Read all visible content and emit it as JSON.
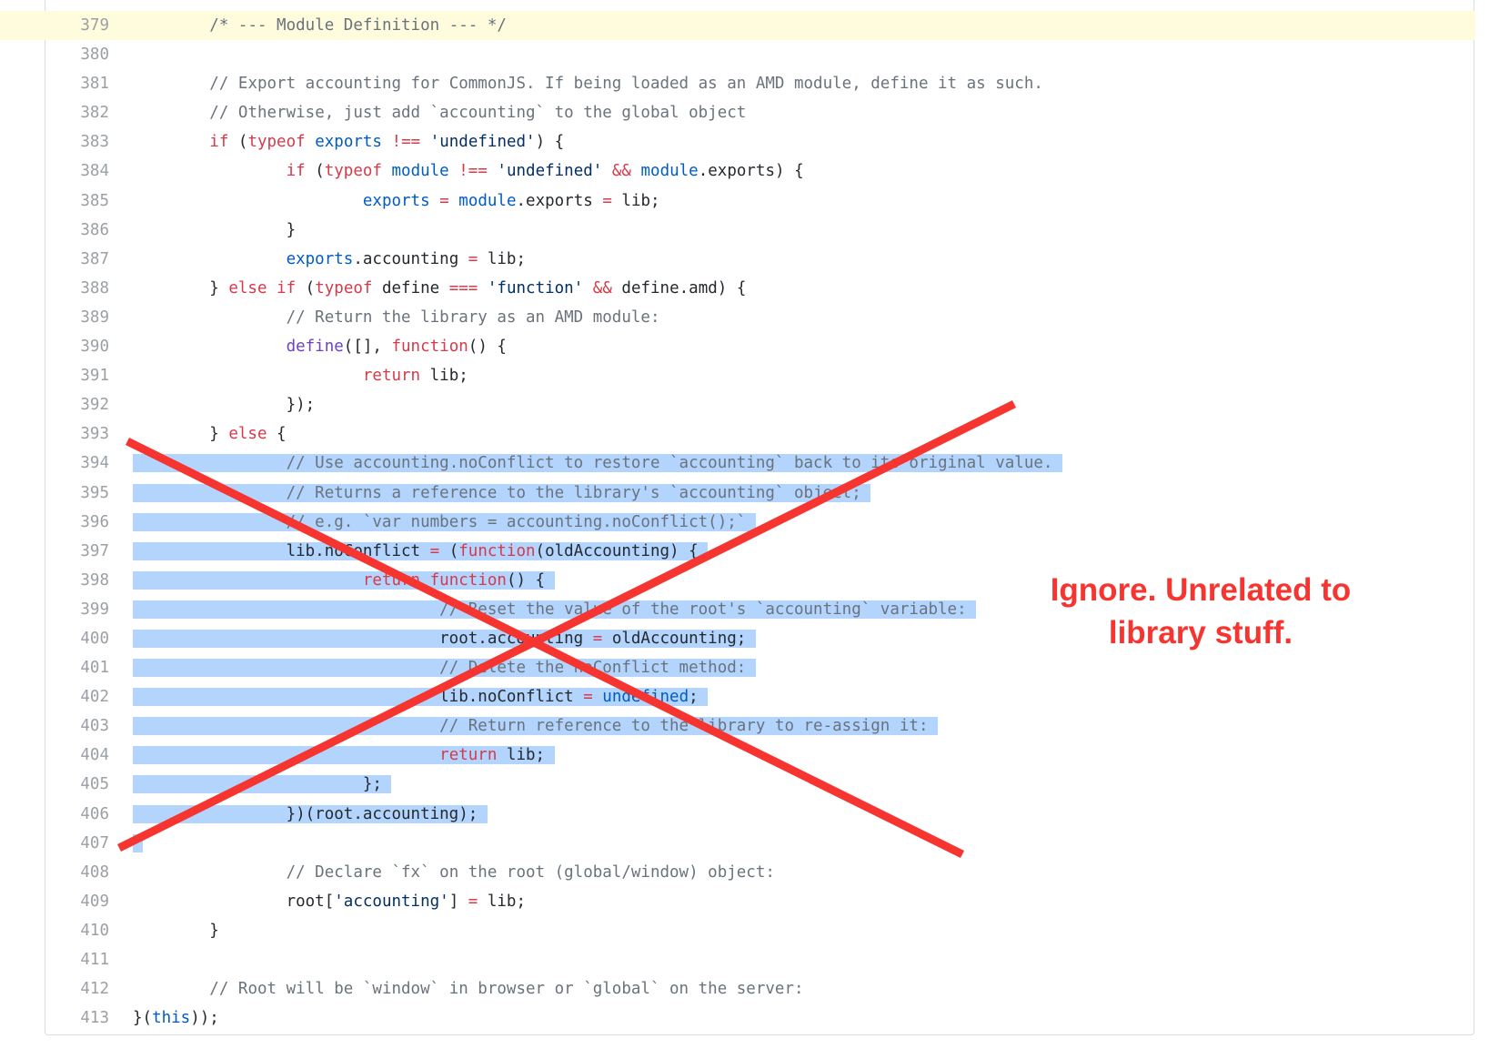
{
  "expander": {
    "label": "•••"
  },
  "highlight_line": "379",
  "selection": {
    "from": "394",
    "to": "407"
  },
  "annotation": {
    "line1": "Ignore. Unrelated to",
    "line2": "library stuff.",
    "color": "#f63531"
  },
  "lines": [
    {
      "num": "379",
      "html": "\t<span class=\"c\">/* --- Module Definition --- */</span>"
    },
    {
      "num": "380",
      "html": ""
    },
    {
      "num": "381",
      "html": "\t<span class=\"c\">// Export accounting for CommonJS. If being loaded as an AMD module, define it as such.</span>"
    },
    {
      "num": "382",
      "html": "\t<span class=\"c\">// Otherwise, just add `accounting` to the global object</span>"
    },
    {
      "num": "383",
      "html": "\t<span class=\"k\">if</span> (<span class=\"k\">typeof</span> <span class=\"v\">exports</span> <span class=\"k\">!==</span> <span class=\"s\">'undefined'</span>) {"
    },
    {
      "num": "384",
      "html": "\t\t<span class=\"k\">if</span> (<span class=\"k\">typeof</span> <span class=\"v\">module</span> <span class=\"k\">!==</span> <span class=\"s\">'undefined'</span> <span class=\"k\">&amp;&amp;</span> <span class=\"v\">module</span>.exports) {"
    },
    {
      "num": "385",
      "html": "\t\t\t<span class=\"v\">exports</span> <span class=\"k\">=</span> <span class=\"v\">module</span>.exports <span class=\"k\">=</span> lib;"
    },
    {
      "num": "386",
      "html": "\t\t}"
    },
    {
      "num": "387",
      "html": "\t\t<span class=\"v\">exports</span>.accounting <span class=\"k\">=</span> lib;"
    },
    {
      "num": "388",
      "html": "\t} <span class=\"k\">else</span> <span class=\"k\">if</span> (<span class=\"k\">typeof</span> define <span class=\"k\">===</span> <span class=\"s\">'function'</span> <span class=\"k\">&amp;&amp;</span> define.amd) {"
    },
    {
      "num": "389",
      "html": "\t\t<span class=\"c\">// Return the library as an AMD module:</span>"
    },
    {
      "num": "390",
      "html": "\t\t<span class=\"f\">define</span>([], <span class=\"k\">function</span>() {"
    },
    {
      "num": "391",
      "html": "\t\t\t<span class=\"k\">return</span> lib;"
    },
    {
      "num": "392",
      "html": "\t\t});"
    },
    {
      "num": "393",
      "html": "\t} <span class=\"k\">else</span> {"
    },
    {
      "num": "394",
      "html": "<span class=\"sel\">\t\t<span class=\"c\">// Use accounting.noConflict to restore `accounting` back to its original value.</span> </span>"
    },
    {
      "num": "395",
      "html": "<span class=\"sel\">\t\t<span class=\"c\">// Returns a reference to the library's `accounting` object;</span> </span>"
    },
    {
      "num": "396",
      "html": "<span class=\"sel\">\t\t<span class=\"c\">// e.g. `var numbers = accounting.noConflict();`</span> </span>"
    },
    {
      "num": "397",
      "html": "<span class=\"sel\">\t\tlib.noConflict <span class=\"k\">=</span> (<span class=\"k\">function</span>(oldAccounting) { </span>"
    },
    {
      "num": "398",
      "html": "<span class=\"sel\">\t\t\t<span class=\"k\">return</span> <span class=\"k\">function</span>() { </span>"
    },
    {
      "num": "399",
      "html": "<span class=\"sel\">\t\t\t\t<span class=\"c\">// Reset the value of the root's `accounting` variable:</span> </span>"
    },
    {
      "num": "400",
      "html": "<span class=\"sel\">\t\t\t\troot.accounting <span class=\"k\">=</span> oldAccounting; </span>"
    },
    {
      "num": "401",
      "html": "<span class=\"sel\">\t\t\t\t<span class=\"c\">// Delete the noConflict method:</span> </span>"
    },
    {
      "num": "402",
      "html": "<span class=\"sel\">\t\t\t\tlib.noConflict <span class=\"k\">=</span> <span class=\"v\">undefined</span>; </span>"
    },
    {
      "num": "403",
      "html": "<span class=\"sel\">\t\t\t\t<span class=\"c\">// Return reference to the library to re-assign it:</span> </span>"
    },
    {
      "num": "404",
      "html": "<span class=\"sel\">\t\t\t\t<span class=\"k\">return</span> lib; </span>"
    },
    {
      "num": "405",
      "html": "<span class=\"sel\">\t\t\t}; </span>"
    },
    {
      "num": "406",
      "html": "<span class=\"sel\">\t\t})(root.accounting); </span>"
    },
    {
      "num": "407",
      "html": "<span class=\"sel\"> </span>"
    },
    {
      "num": "408",
      "html": "\t\t<span class=\"c\">// Declare `fx` on the root (global/window) object:</span>"
    },
    {
      "num": "409",
      "html": "\t\troot[<span class=\"s\">'accounting'</span>] <span class=\"k\">=</span> lib;"
    },
    {
      "num": "410",
      "html": "\t}"
    },
    {
      "num": "411",
      "html": ""
    },
    {
      "num": "412",
      "html": "\t<span class=\"c\">// Root will be `window` in browser or `global` on the server:</span>"
    },
    {
      "num": "413",
      "html": "}(<span class=\"v\">this</span>));"
    }
  ]
}
